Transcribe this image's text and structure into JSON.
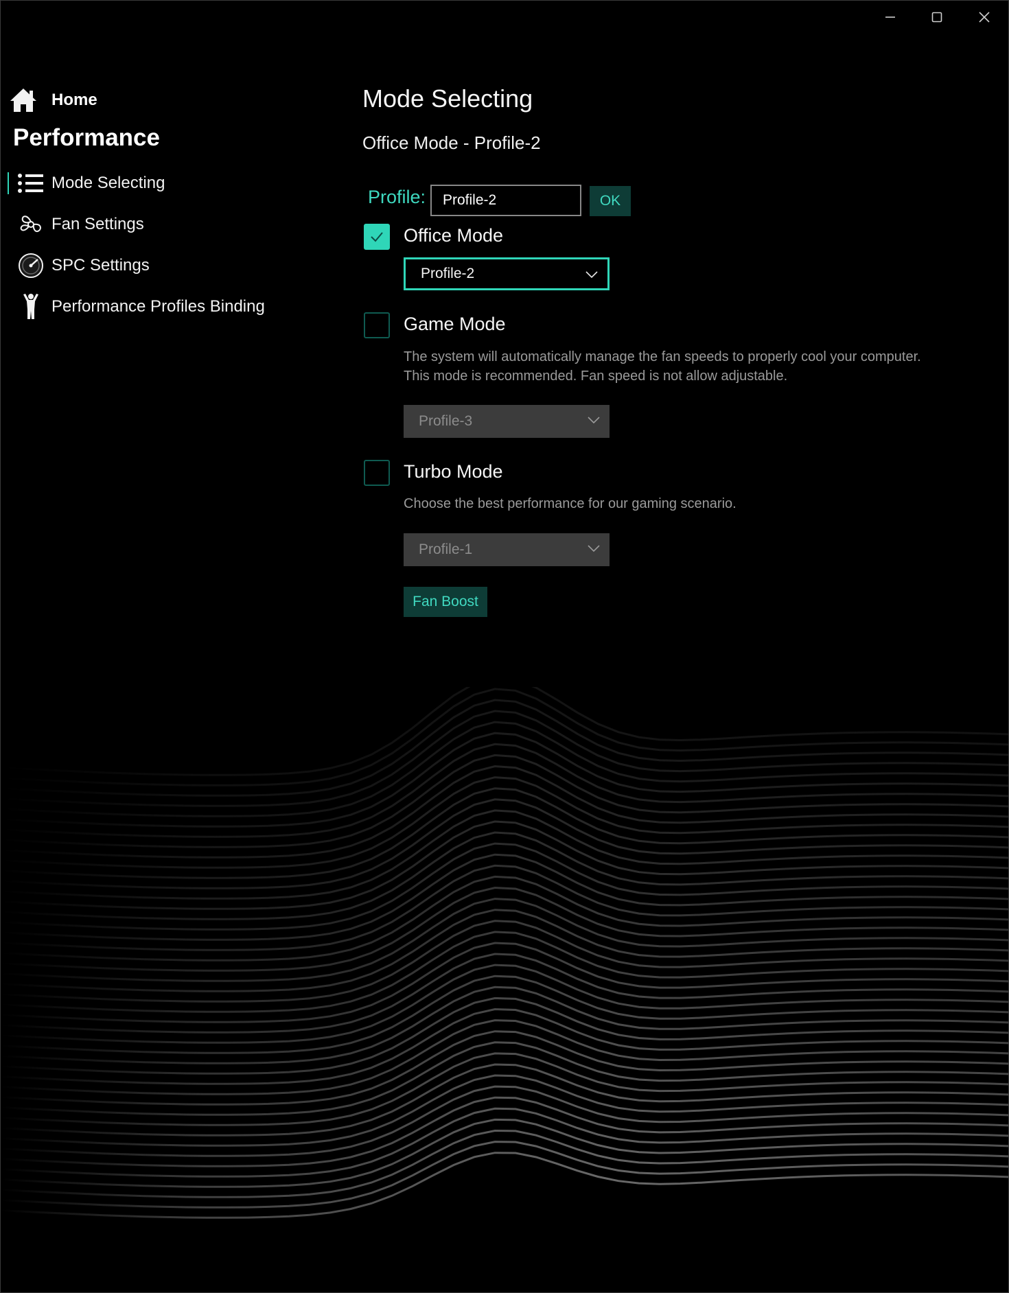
{
  "window": {
    "minimize_icon": "minimize-icon",
    "maximize_icon": "maximize-icon",
    "close_icon": "close-icon"
  },
  "sidebar": {
    "home_label": "Home",
    "section_title": "Performance",
    "items": [
      {
        "label": "Mode Selecting",
        "icon": "list-icon",
        "active": true
      },
      {
        "label": "Fan Settings",
        "icon": "fan-icon",
        "active": false
      },
      {
        "label": "SPC Settings",
        "icon": "gauge-icon",
        "active": false
      },
      {
        "label": "Performance Profiles Binding",
        "icon": "person-icon",
        "active": false
      }
    ]
  },
  "main": {
    "title": "Mode Selecting",
    "subtitle": "Office Mode - Profile-2",
    "profile_label": "Profile:",
    "profile_value": "Profile-2",
    "ok_label": "OK",
    "modes": [
      {
        "label": "Office Mode",
        "checked": true,
        "description": "",
        "selected_profile": "Profile-2"
      },
      {
        "label": "Game Mode",
        "checked": false,
        "description_line1": "The system will automatically manage the fan speeds to properly cool your computer.",
        "description_line2": "This mode is recommended. Fan speed is not allow adjustable.",
        "selected_profile": "Profile-3"
      },
      {
        "label": "Turbo Mode",
        "checked": false,
        "description_line1": "Choose the best performance for our gaming scenario.",
        "selected_profile": "Profile-1"
      }
    ],
    "fan_boost_label": "Fan Boost"
  },
  "colors": {
    "accent": "#2fd6b8",
    "accent_dark": "#0e3c36",
    "background": "#000000",
    "muted_text": "#9a9a9a",
    "disabled_fill": "#3c3c3c"
  }
}
